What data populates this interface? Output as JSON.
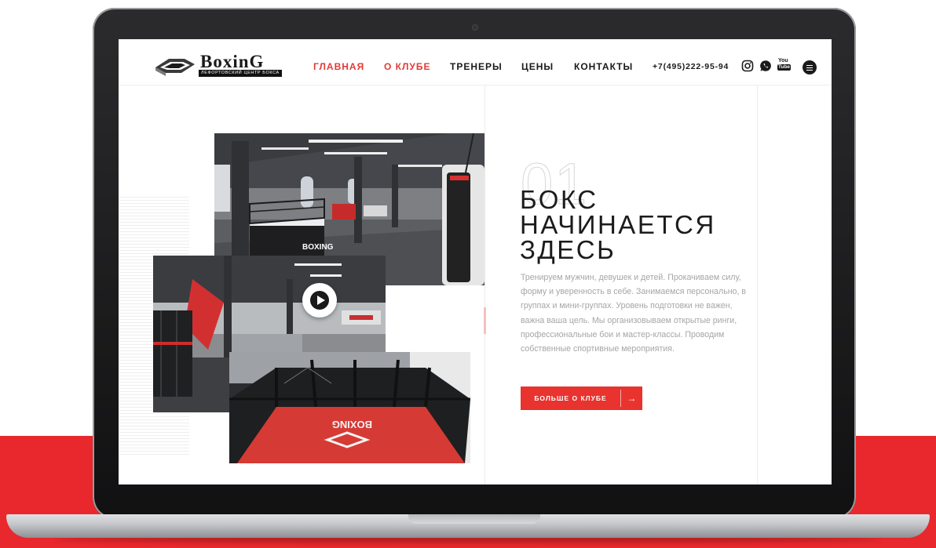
{
  "brand": {
    "name": "BoxinG",
    "subtitle": "ЛЕФОРТОВСКИЙ ЦЕНТР БОКСА"
  },
  "nav": {
    "items": [
      {
        "label": "ГЛАВНАЯ",
        "active": true
      },
      {
        "label": "О КЛУБЕ",
        "active": true
      },
      {
        "label": "ТРЕНЕРЫ",
        "active": false
      },
      {
        "label": "ЦЕНЫ",
        "active": false
      },
      {
        "label": "КОНТАКТЫ",
        "active": false
      }
    ],
    "phone": "+7(495)222-95-94"
  },
  "social": {
    "icons": [
      "instagram-icon",
      "whatsapp-icon",
      "youtube-icon"
    ],
    "youtube_text_top": "You",
    "youtube_text_bottom": "Tube"
  },
  "hero": {
    "number": "01",
    "heading_lines": [
      "БОКС",
      "НАЧИНАЕТСЯ",
      "ЗДЕСЬ"
    ],
    "description": "Тренируем мужчин, девушек и детей. Прокачиваем силу, форму и уверенность в себе. Занимаемся персонально, в группах и мини-группах. Уровень подготовки не важен, важна ваша цель. Мы организовываем открытые ринги, профессиональные бои и мастер-классы. Проводим собственные спортивные мероприятия.",
    "cta_label": "БОЛЬШЕ О КЛУБЕ",
    "cta_arrow": "→"
  },
  "photos": {
    "ring_logo_text": "BOXING",
    "cage_logo_text": "BOXING"
  },
  "colors": {
    "accent": "#e8332f",
    "background_band": "#e8282d",
    "text_dark": "#1a1a1a",
    "text_muted": "#a6a6a6"
  }
}
